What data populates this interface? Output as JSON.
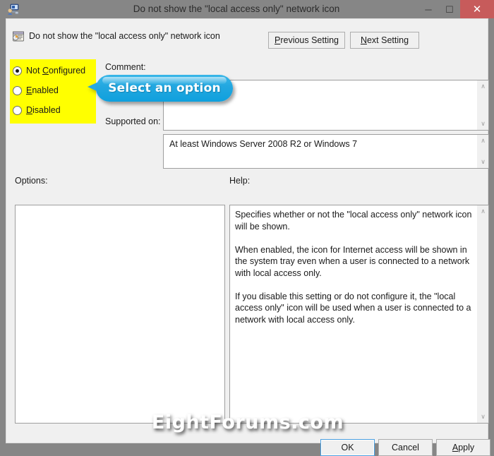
{
  "window": {
    "title": "Do not show the \"local access only\" network icon",
    "icon": "network-computer-icon",
    "controls": {
      "minimize": "–",
      "maximize": "☐",
      "close": "✕"
    },
    "accent_close": "#c75b5b",
    "titlebar_color": "#868686",
    "client_color": "#f0f0f0"
  },
  "header": {
    "icon": "policy-setting-icon",
    "setting_name": "Do not show the \"local access only\" network icon",
    "previous_setting": "Previous Setting",
    "previous_accel": "P",
    "next_setting": "Next Setting",
    "next_accel": "N"
  },
  "state_options": {
    "highlight_color": "#ffff00",
    "items": [
      {
        "label": "Not Configured",
        "accel": "C",
        "accel_index": 4,
        "checked": true,
        "name": "not-configured"
      },
      {
        "label": "Enabled",
        "accel": "E",
        "accel_index": 0,
        "checked": false,
        "name": "enabled"
      },
      {
        "label": "Disabled",
        "accel": "D",
        "accel_index": 0,
        "checked": false,
        "name": "disabled"
      }
    ]
  },
  "comment": {
    "label": "Comment:",
    "value": "",
    "placeholder": ""
  },
  "supported_on": {
    "label": "Supported on:",
    "value": "At least Windows Server 2008 R2 or Windows 7"
  },
  "options": {
    "label": "Options:",
    "value": ""
  },
  "help": {
    "label": "Help:",
    "text": "Specifies whether or not the \"local access only\" network icon will be shown.\n\nWhen enabled, the icon for Internet access will be shown in the system tray even when a user is connected to a network with local access only.\n\nIf you disable this setting or do not configure it, the \"local access only\" icon will be used when a user is connected to a network with local access only."
  },
  "callout": {
    "text": "Select an option",
    "fill_color": "#22a7e0",
    "text_color": "#ffffff"
  },
  "watermark": {
    "text": "EightForums.com"
  },
  "footer": {
    "ok": "OK",
    "cancel": "Cancel",
    "apply": "Apply",
    "apply_accel": "A",
    "focused": "OK"
  },
  "scrollbar": {
    "up_glyph": "∧",
    "down_glyph": "∨"
  }
}
